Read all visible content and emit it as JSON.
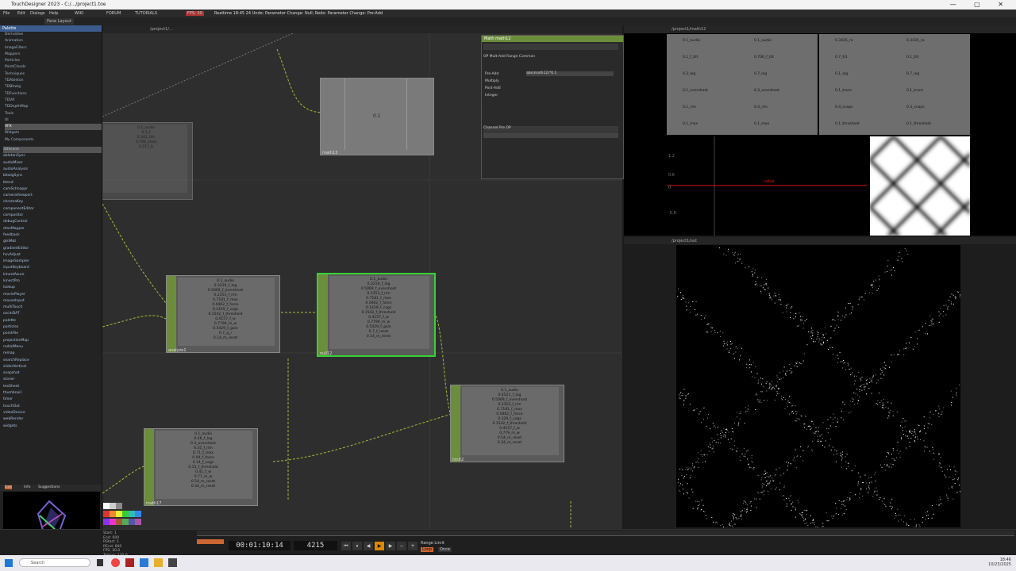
{
  "window": {
    "title": "TouchDesigner 2023 - C:/.../project1.toe"
  },
  "menu": {
    "items": [
      "File",
      "Edit",
      "Dialogs",
      "Help",
      "WIKI",
      "FORUM",
      "TUTORIALS"
    ],
    "fps": "FPS: 30",
    "status": "Realtime  18:45 24  Undo: Parameter Change: Null; Redo: Parameter Change: Pre:Add"
  },
  "panes": {
    "tab1": "Pane Layout",
    "net_path": "/project1/..."
  },
  "palette": {
    "title": "Palette",
    "tree": [
      "Derivative",
      "Animation",
      "ImageFilters",
      "Mappers",
      "Particles",
      "PointClouds",
      "Techniques",
      "TDAbleton",
      "TDBitwig",
      "TDFunctions",
      "TDVR",
      "TDDepthMap",
      "Tools",
      "UI",
      "VFX",
      "Widgets",
      "My Components"
    ],
    "items": [
      "3DScene",
      "abletonSync",
      "audioMixer",
      "audioAnalysis",
      "bitwigSync",
      "blend",
      "camSchnappr",
      "cameraViewport",
      "chromaKey",
      "componentEditor",
      "compositor",
      "debugControl",
      "dmxMapper",
      "feedback",
      "glslMat",
      "gradientEditor",
      "hsvAdjust",
      "imageSampler",
      "inputKeyboard",
      "kinectAzure",
      "kinectPro",
      "lookup",
      "moviePlayer",
      "mouseInput",
      "multiTouch",
      "oscInDAT",
      "palette",
      "particles",
      "pointFile",
      "projectionMap",
      "radialMenu",
      "remap",
      "searchReplace",
      "sliderVertical",
      "snapshot",
      "stoner",
      "texSheet",
      "thumbnail",
      "timer",
      "touchOut",
      "videoDevice",
      "webRender",
      "widgets"
    ],
    "bottom_tabs": [
      "Icon",
      "Info",
      "Suggestions"
    ]
  },
  "nodes": {
    "n1": {
      "label": "noise1",
      "lines": [
        "0.1_audio",
        "0.1_f",
        "0.342_tile",
        "0.706_shad",
        "0.217_b"
      ]
    },
    "n2": {
      "label": "math13",
      "value": "0.1"
    },
    "n3": {
      "label": "analyze1",
      "lines": [
        "0.1_audio",
        "0.3219_f_log",
        "0.5069_f_overshoot",
        "0.2353_f_rim",
        "0.7181_f_max",
        "0.0462_f_force",
        "0.1429_f_cogs",
        "0.1542_f_threshold",
        "0.4157_f_w",
        "0.7799_m_w",
        "0.5429_f_gain",
        "0.7_q_r",
        "0.14_m_reset"
      ]
    },
    "n4": {
      "label": "null12",
      "lines": [
        "0.1_audio",
        "0.3219_f_log",
        "0.5069_f_overshoot",
        "0.2353_f_rim",
        "0.7181_f_max",
        "0.0462_f_force",
        "0.1429_f_cogs",
        "0.1542_f_threshold",
        "0.4157_f_w",
        "0.7799_m_w",
        "0.5429_f_gain",
        "0.7_f_reset",
        "0.14_m_reset"
      ]
    },
    "n5": {
      "label": "limit2",
      "lines": [
        "0.1_audio",
        "0.4521_f_log",
        "0.5069_f_overshoot",
        "0.2353_f_rim",
        "0.7181_f_max",
        "0.0462_f_force",
        "0.329_f_cogs",
        "0.1542_f_threshold",
        "0.4157_f_w",
        "0.779_m_w",
        "0.54_m_reset",
        "0.34_m_reset"
      ]
    },
    "n6": {
      "label": "math17",
      "lines": [
        "0.1_audio",
        "0.46_f_log",
        "0.3_overshoot",
        "0.35_f_rim",
        "0.71_f_max",
        "0.04_f_force",
        "0.14_f_cogs",
        "0.15_f_threshold",
        "0.41_f_w",
        "0.77_m_w",
        "0.54_m_reset",
        "0.34_m_reset"
      ]
    }
  },
  "params": {
    "header": "Math  math12",
    "tabs": "OP  Mult-Add  Range  Common",
    "rows": [
      "Pre-Add",
      "Multiply",
      "Post-Add",
      "Integer"
    ],
    "label_row": "Channel Pre OP",
    "value_field": "abs(math12)*0.1"
  },
  "viewer": {
    "path_top": "/project1/math12",
    "path_bot": "/project1/out",
    "table_left": [
      [
        "0.1_audio",
        "0.1_audio"
      ],
      [
        "0.1_f_tilt",
        "0.706_f_tilt"
      ],
      [
        "0.3_log",
        "0.7_log"
      ],
      [
        "0.1_overshoot",
        "0.3_overshoot"
      ],
      [
        "0.1_rim",
        "0.4_rim"
      ],
      [
        "0.1_max",
        "0.1_max"
      ]
    ],
    "table_right": [
      [
        "0.3435_ra",
        "0.3435_ra"
      ],
      [
        "0.7_tilt",
        "0.1_tilt"
      ],
      [
        "0.1_log",
        "0.7_log"
      ],
      [
        "0.1_trace",
        "0.1_trace"
      ],
      [
        "0.4_snaps",
        "0.3_snaps"
      ],
      [
        "0.1_threshold",
        "0.1_threshold"
      ]
    ],
    "graph_label": "value",
    "graph_ticks": [
      "1.2",
      "0.6",
      "0",
      "-0.6"
    ]
  },
  "timeline": {
    "timecode": "00:01:10:14",
    "frame": "4215",
    "range_label": "Range Limit",
    "loop": "Loop",
    "once": "Once",
    "info": [
      "Start:",
      "End:",
      "RStart:",
      "REnd:",
      "FPS:",
      "Tempo:",
      "ResetF:"
    ],
    "info_vals": [
      "1",
      "600",
      "1",
      "600",
      "30.0",
      "120.0",
      "1"
    ]
  },
  "taskbar": {
    "search": "Search",
    "time": "18:46",
    "date": "10/23/2025"
  },
  "colors": {
    "accent": "#6c8d3c",
    "selected": "#36d136",
    "palette_hdr": "#3b5b8c"
  }
}
